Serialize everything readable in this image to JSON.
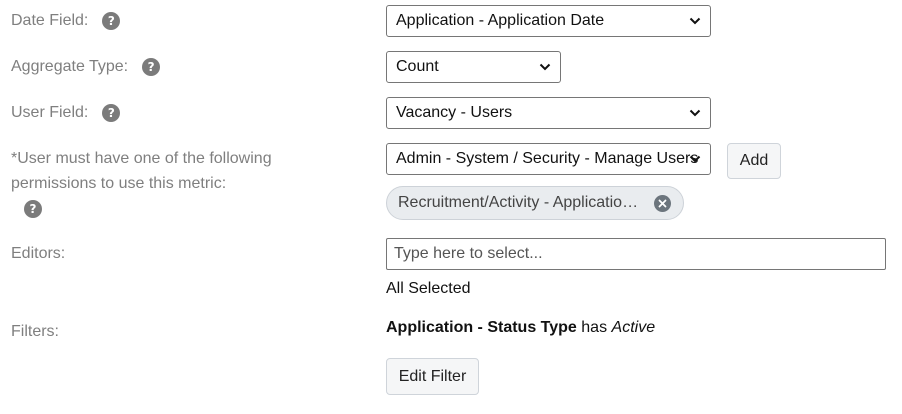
{
  "fields": {
    "date_field": {
      "label": "Date Field:",
      "value": "Application - Application Date"
    },
    "aggregate_type": {
      "label": "Aggregate Type:",
      "value": "Count"
    },
    "user_field": {
      "label": "User Field:",
      "value": "Vacancy - Users"
    },
    "permissions": {
      "label_line1": "*User must have one of the following",
      "label_line2": "permissions to use this metric:",
      "value": "Admin - System / Security - Manage Users",
      "add_label": "Add",
      "selected_chip": "Recruitment/Activity - Application Admin"
    },
    "editors": {
      "label": "Editors:",
      "placeholder": "Type here to select...",
      "summary": "All Selected"
    },
    "filters": {
      "label": "Filters:",
      "field": "Application - Status Type",
      "operator": "has",
      "value": "Active",
      "edit_label": "Edit Filter"
    }
  },
  "icons": {
    "help": "question-circle-icon",
    "dropdown": "chevron-down-icon",
    "remove": "close-circle-icon"
  },
  "colors": {
    "label": "#7f7f7f",
    "help_icon": "#7b7b7b",
    "chip_bg": "#e9ecef"
  }
}
